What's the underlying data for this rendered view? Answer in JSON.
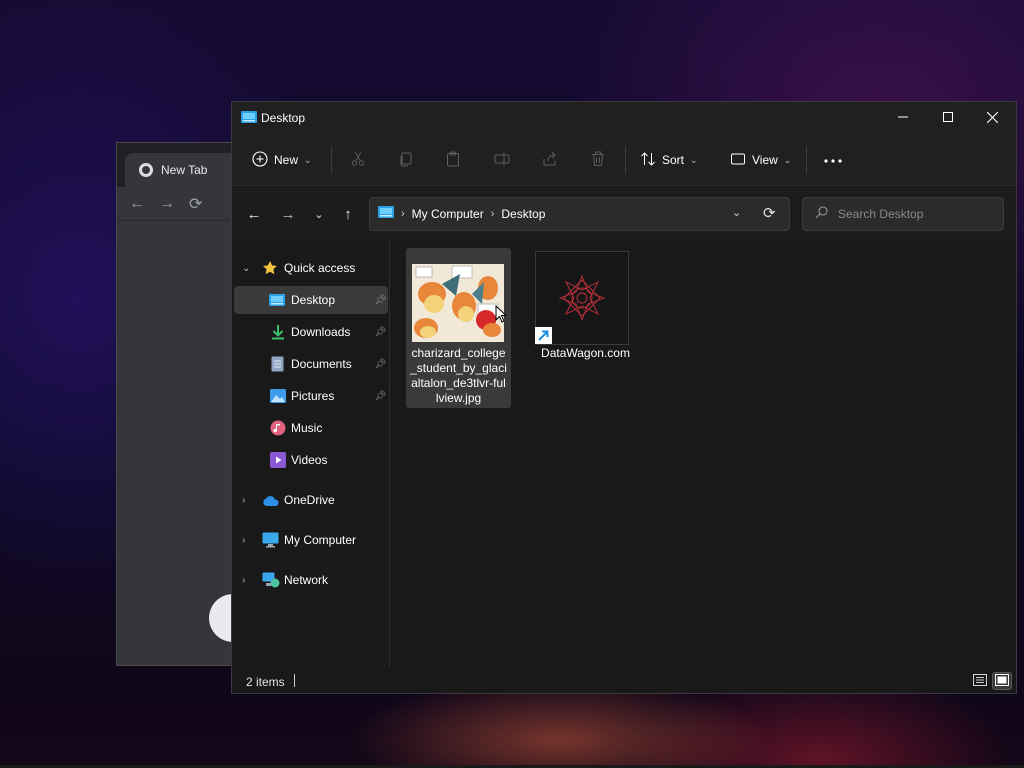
{
  "chrome": {
    "tab_title": "New Tab"
  },
  "explorer": {
    "title": "Desktop",
    "toolbar": {
      "new_label": "New",
      "sort_label": "Sort",
      "view_label": "View"
    },
    "address": {
      "crumbs": [
        "My Computer",
        "Desktop"
      ]
    },
    "search": {
      "placeholder": "Search Desktop"
    },
    "nav": {
      "quick_access": "Quick access",
      "items": [
        {
          "label": "Desktop",
          "pinned": true
        },
        {
          "label": "Downloads",
          "pinned": true
        },
        {
          "label": "Documents",
          "pinned": true
        },
        {
          "label": "Pictures",
          "pinned": true
        },
        {
          "label": "Music",
          "pinned": false
        },
        {
          "label": "Videos",
          "pinned": false
        }
      ],
      "roots": [
        "OneDrive",
        "My Computer",
        "Network"
      ]
    },
    "files": [
      {
        "name": "charizard_college_student_by_glacialtalon_de3tlvr-fullview.jpg",
        "selected": true
      },
      {
        "name": "DataWagon.com",
        "selected": false,
        "shortcut": true
      }
    ],
    "status": {
      "item_count": "2 items"
    }
  },
  "colors": {
    "folder_blue": "#4cc2ff",
    "star": "#f5c542",
    "onedrive": "#2f8ee6",
    "download_green": "#3fbf6c"
  }
}
